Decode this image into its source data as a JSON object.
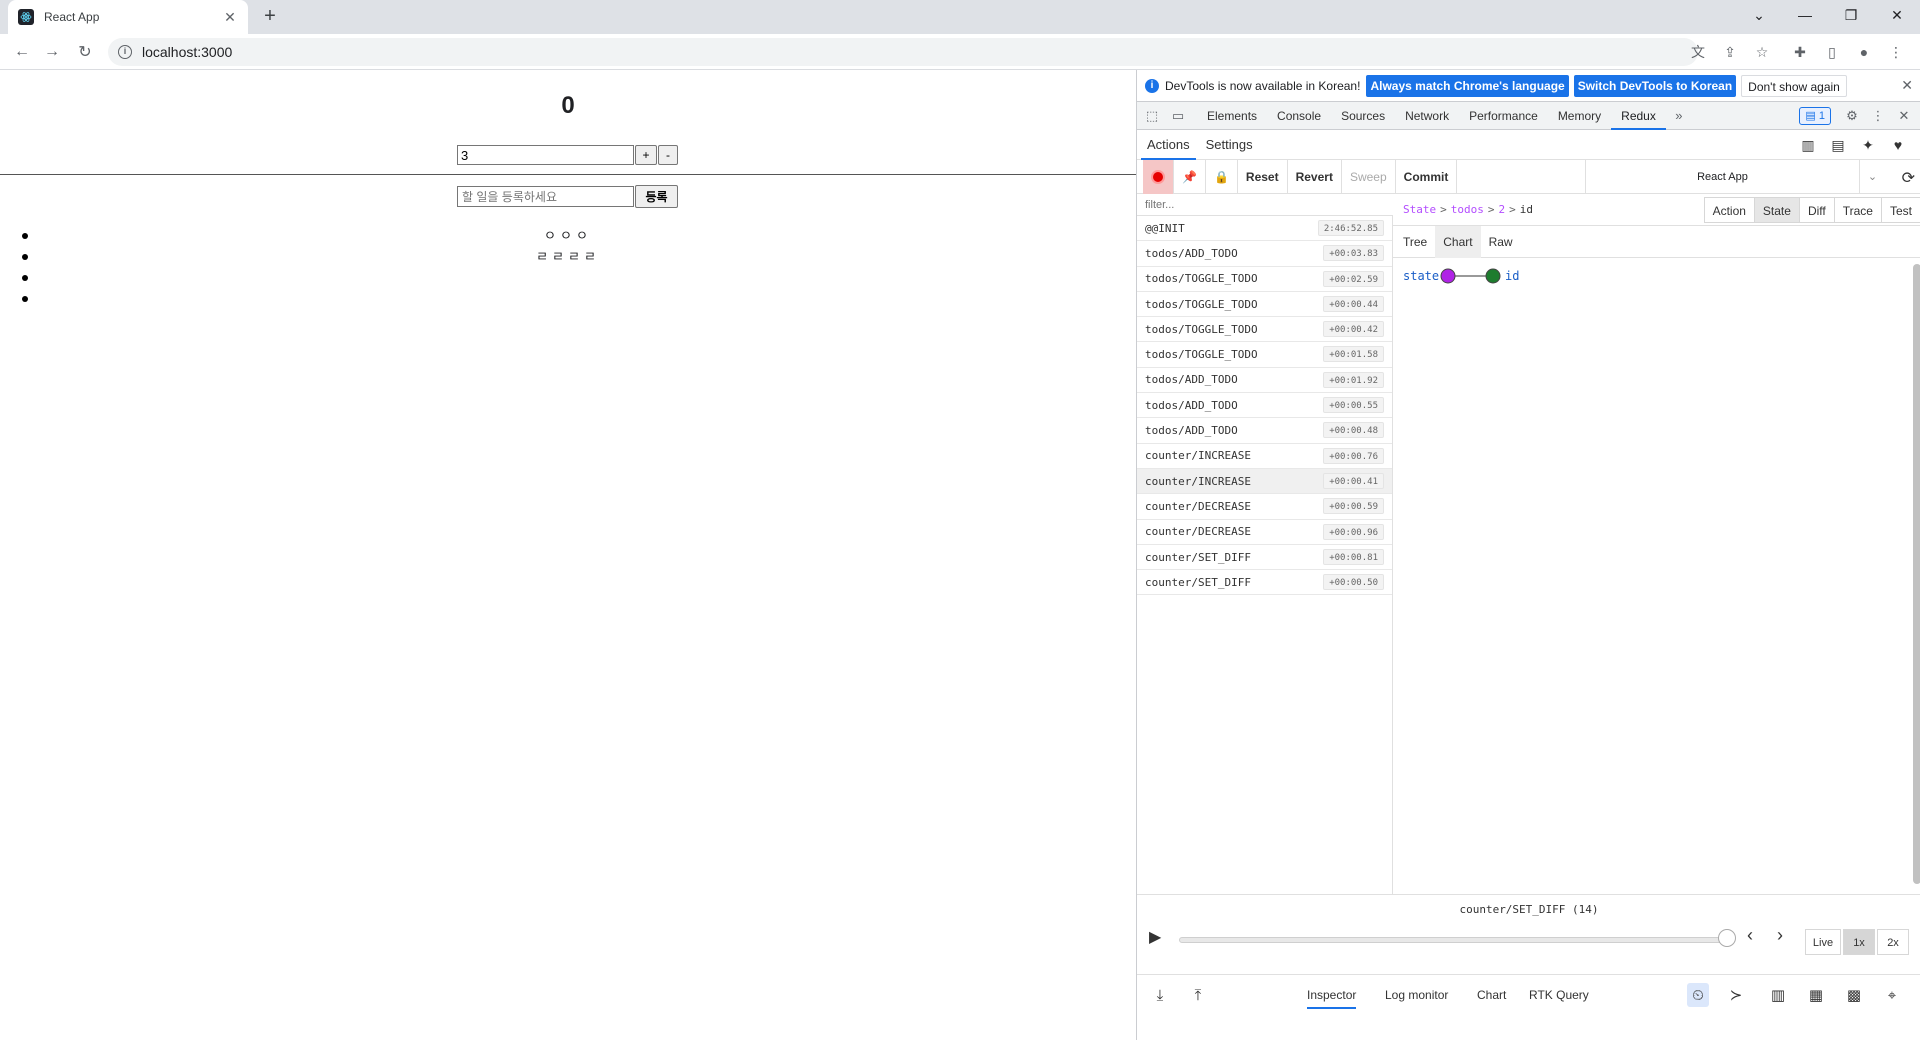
{
  "browser": {
    "tab_title": "React App",
    "url": "localhost:3000"
  },
  "page": {
    "counter_number": "0",
    "counter_input_value": "3",
    "increase_label": "+",
    "decrease_label": "-",
    "todo_placeholder": "할 일을 등록하세요",
    "register_label": "등록",
    "todos": [
      "ㅇㅇㅇ",
      "ㄹㄹㄹㄹ",
      "",
      ""
    ]
  },
  "devtools": {
    "info_message": "DevTools is now available in Korean!",
    "match_language_label": "Always match Chrome's language",
    "switch_korean_label": "Switch DevTools to Korean",
    "dont_show_label": "Don't show again",
    "tabs": [
      "Elements",
      "Console",
      "Sources",
      "Network",
      "Performance",
      "Memory",
      "Redux"
    ],
    "issues_count": "1"
  },
  "redux": {
    "top_tabs": [
      "Actions",
      "Settings"
    ],
    "buttons": {
      "reset": "Reset",
      "revert": "Revert",
      "sweep": "Sweep",
      "commit": "Commit"
    },
    "instance_name": "React App",
    "filter_placeholder": "filter...",
    "actions": [
      {
        "name": "@@INIT",
        "time": "2:46:52.85"
      },
      {
        "name": "todos/ADD_TODO",
        "time": "+00:03.83"
      },
      {
        "name": "todos/TOGGLE_TODO",
        "time": "+00:02.59"
      },
      {
        "name": "todos/TOGGLE_TODO",
        "time": "+00:00.44"
      },
      {
        "name": "todos/TOGGLE_TODO",
        "time": "+00:00.42"
      },
      {
        "name": "todos/TOGGLE_TODO",
        "time": "+00:01.58"
      },
      {
        "name": "todos/ADD_TODO",
        "time": "+00:01.92"
      },
      {
        "name": "todos/ADD_TODO",
        "time": "+00:00.55"
      },
      {
        "name": "todos/ADD_TODO",
        "time": "+00:00.48"
      },
      {
        "name": "counter/INCREASE",
        "time": "+00:00.76"
      },
      {
        "name": "counter/INCREASE",
        "time": "+00:00.41"
      },
      {
        "name": "counter/DECREASE",
        "time": "+00:00.59"
      },
      {
        "name": "counter/DECREASE",
        "time": "+00:00.96"
      },
      {
        "name": "counter/SET_DIFF",
        "time": "+00:00.81"
      },
      {
        "name": "counter/SET_DIFF",
        "time": "+00:00.50"
      }
    ],
    "selected_action_index": 10,
    "breadcrumb": [
      "State",
      "todos",
      "2",
      "id"
    ],
    "state_tabs": [
      "Action",
      "State",
      "Diff",
      "Trace",
      "Test"
    ],
    "active_state_tab": "State",
    "view_tabs": [
      "Tree",
      "Chart",
      "Raw"
    ],
    "active_view_tab": "Chart",
    "chart_nodes": [
      "state",
      "id"
    ],
    "slider_label": "counter/SET_DIFF",
    "slider_count": "(14)",
    "slider_progress": 1.0,
    "speed_options": [
      "Live",
      "1x",
      "2x"
    ],
    "active_speed": "1x",
    "monitors": [
      "Inspector",
      "Log monitor",
      "Chart",
      "RTK Query"
    ],
    "active_monitor": "Inspector"
  }
}
